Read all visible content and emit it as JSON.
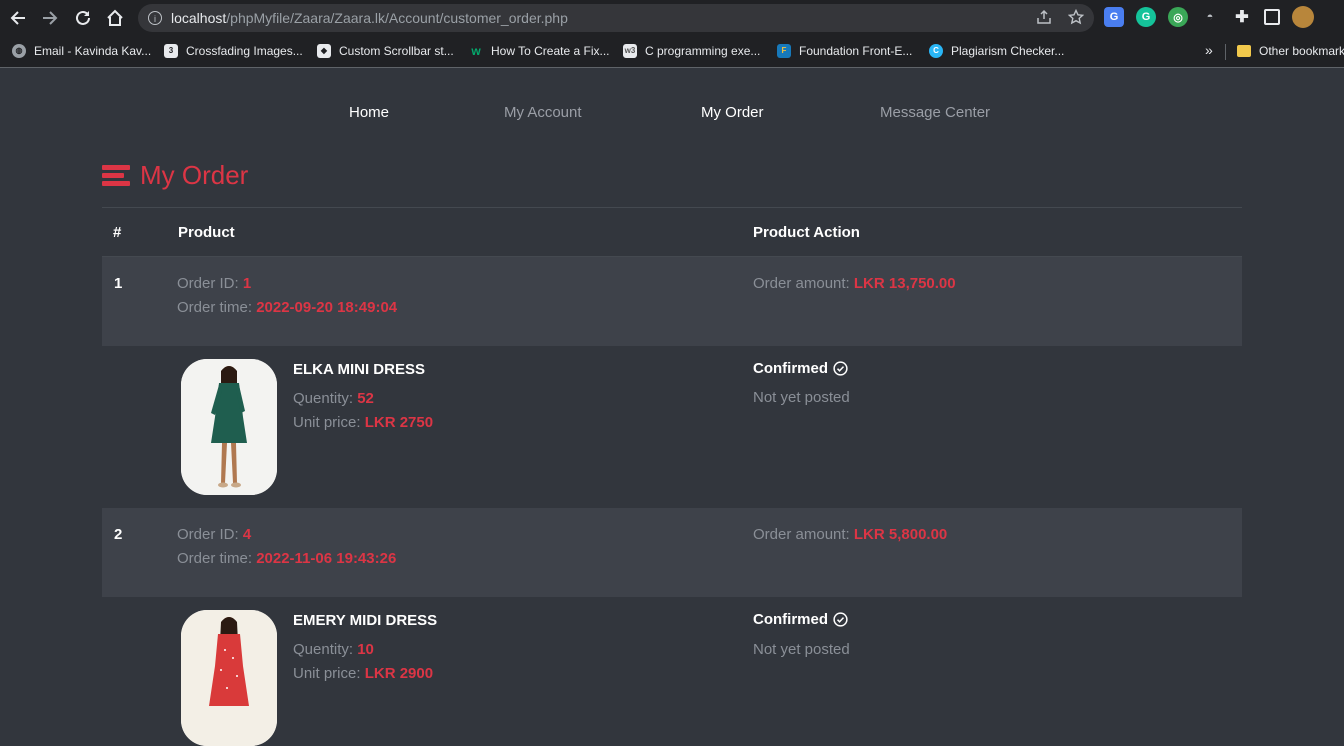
{
  "browser": {
    "url_host": "localhost",
    "url_path": "/phpMyfile/Zaara/Zaara.lk/Account/customer_order.php",
    "bookmarks": [
      {
        "label": "Email - Kavinda Kav...",
        "icon": "globe-icon"
      },
      {
        "label": "Crossfading Images...",
        "icon": "css3-icon"
      },
      {
        "label": "Custom Scrollbar st...",
        "icon": "codepen-icon"
      },
      {
        "label": "How To Create a Fix...",
        "icon": "w3schools-icon"
      },
      {
        "label": "C programming exe...",
        "icon": "w3resource-icon"
      },
      {
        "label": "Foundation Front-E...",
        "icon": "foundation-icon"
      },
      {
        "label": "Plagiarism Checker...",
        "icon": "plagiarism-icon"
      }
    ],
    "more_bookmarks": "»",
    "other_bookmarks": "Other bookmarks"
  },
  "nav": {
    "items": [
      {
        "label": "Home",
        "active": true
      },
      {
        "label": "My Account",
        "active": false
      },
      {
        "label": "My Order",
        "active": true
      },
      {
        "label": "Message Center",
        "active": false
      }
    ]
  },
  "page": {
    "title": "My Order",
    "accent": "#dc3545"
  },
  "table": {
    "headers": {
      "num": "#",
      "product": "Product",
      "action": "Product Action"
    },
    "labels": {
      "order_id": "Order ID:",
      "order_time": "Order time:",
      "order_amount": "Order amount:",
      "quantity": "Quentity:",
      "unit_price": "Unit price:"
    },
    "orders": [
      {
        "num": "1",
        "order_id": "1",
        "order_time": "2022-09-20 18:49:04",
        "amount": "LKR 13,750.00",
        "product": {
          "name": "ELKA MINI DRESS",
          "quantity": "52",
          "unit_price": "LKR 2750",
          "status": "Confirmed",
          "post_status": "Not yet posted",
          "dress_color": "#1f5e4f"
        }
      },
      {
        "num": "2",
        "order_id": "4",
        "order_time": "2022-11-06 19:43:26",
        "amount": "LKR 5,800.00",
        "product": {
          "name": "EMERY MIDI DRESS",
          "quantity": "10",
          "unit_price": "LKR 2900",
          "status": "Confirmed",
          "post_status": "Not yet posted",
          "dress_color": "#d93a3a"
        }
      }
    ]
  }
}
